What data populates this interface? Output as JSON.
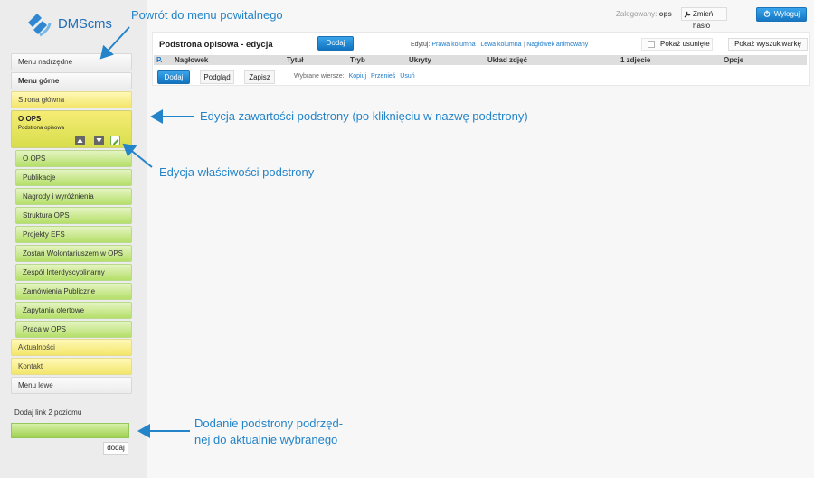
{
  "logo": {
    "text": "DMScms"
  },
  "sidebar": {
    "menu_nadrzedne": "Menu nadrzędne",
    "menu_gorne": "Menu górne",
    "strona_glowna": "Strona główna",
    "selected": {
      "title": "O OPS",
      "subtitle": "Podstrona opisowa"
    },
    "subitems": [
      "O OPS",
      "Publikacje",
      "Nagrody i wyróżnienia",
      "Struktura OPS",
      "Projekty EFS",
      "Zostań Wolontariuszem w OPS",
      "Zespół Interdyscyplinarny",
      "Zamówienia Publiczne",
      "Zapytania ofertowe",
      "Praca w OPS"
    ],
    "aktualnosci": "Aktualności",
    "kontakt": "Kontakt",
    "menu_lewe": "Menu lewe",
    "add_level2_label": "Dodaj link 2 poziomu",
    "add_button": "dodaj"
  },
  "topbar": {
    "logged_label": "Zalogowany:",
    "user": "ops",
    "change_password": "Zmień hasło",
    "logout": "Wyloguj"
  },
  "panel": {
    "title": "Podstrona opisowa - edycja",
    "add_button": "Dodaj",
    "edit_label": "Edytuj:",
    "edit_links": [
      "Prawa kolumna",
      "Lewa kolumna",
      "Nagłówek animowany"
    ],
    "show_deleted": "Pokaż usunięte",
    "show_search": "Pokaż wyszukiwarkę",
    "columns": [
      "P.",
      "Nagłowek",
      "Tytuł",
      "Tryb",
      "Ukryty",
      "Układ zdjęć",
      "1 zdjęcie",
      "Opcje"
    ],
    "buttons": [
      "Dodaj",
      "Podgląd",
      "Zapisz"
    ],
    "selected_rows_label": "Wybrane wiersze:",
    "row_actions": [
      "Kopiuj",
      "Przenieś",
      "Usuń"
    ]
  },
  "annotations": {
    "a1": "Powrót do menu powitalnego",
    "a2": "Edycja zawartości podstrony (po kliknięciu w nazwę podstrony)",
    "a3": "Edycja właściwości podstrony",
    "a4_line1": "Dodanie podstrony podrzęd-",
    "a4_line2": "nej do aktualnie wybranego"
  },
  "colors": {
    "accent": "#1b79c9",
    "annotation": "#2484c9"
  },
  "icons": [
    "logo-icon",
    "arrow-up-icon",
    "arrow-down-icon",
    "edit-icon",
    "wrench-icon",
    "power-icon"
  ]
}
